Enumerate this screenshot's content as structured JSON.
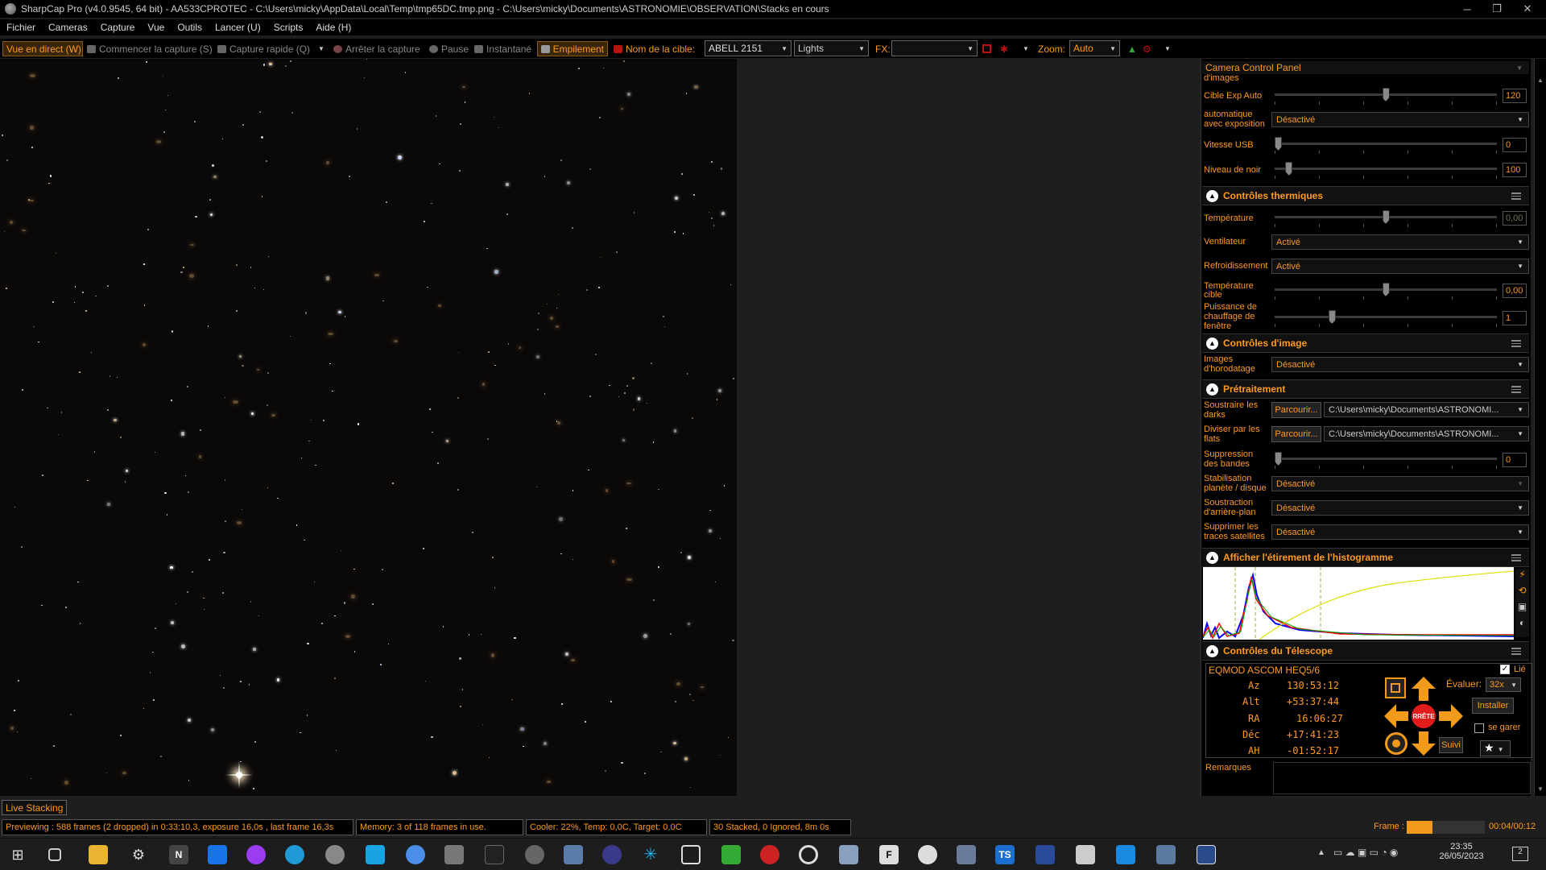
{
  "window": {
    "title": "SharpCap Pro (v4.0.9545, 64 bit) - AA533CPROTEC - C:\\Users\\micky\\AppData\\Local\\Temp\\tmp65DC.tmp.png - C:\\Users\\micky\\Documents\\ASTRONOMIE\\OBSERVATION\\Stacks en cours",
    "minimize": "─",
    "restore": "❐",
    "close": "✕"
  },
  "menu": [
    "Fichier",
    "Cameras",
    "Capture",
    "Vue",
    "Outils",
    "Lancer (U)",
    "Scripts",
    "Aide (H)"
  ],
  "toolbar": {
    "live_view": "Vue en direct (W)",
    "start_capture": "Commencer la capture (S)",
    "quick_capture": "Capture rapide (Q)",
    "stop_capture": "Arrêter la capture",
    "pause": "Pause",
    "snapshot": "Instantané",
    "stacking": "Empilement",
    "target_label": "Nom de la cible:",
    "target_value": "ABELL 2151",
    "frame_type": "Lights",
    "fx_label": "FX:",
    "fx_value": "",
    "zoom_label": "Zoom:",
    "zoom_value": "Auto"
  },
  "panel": {
    "title": "Camera Control Panel",
    "cut_label": "d'images",
    "cible_exp": {
      "label": "Cible Exp Auto",
      "value": "120",
      "level": 0.5
    },
    "auto_gain": {
      "label1": "automatique",
      "label2": "avec exposition",
      "value": "Désactivé"
    },
    "usb": {
      "label": "Vitesse USB",
      "value": "0",
      "level": 0.0
    },
    "black": {
      "label": "Niveau de noir",
      "value": "100",
      "level": 0.05
    },
    "thermal": {
      "header": "Contrôles thermiques",
      "temp": {
        "label": "Température",
        "value": "0,00",
        "level": 0.5
      },
      "fan": {
        "label": "Ventilateur",
        "value": "Activé"
      },
      "cooling": {
        "label": "Refroidissement",
        "value": "Activé"
      },
      "target_temp": {
        "label1": "Température",
        "label2": "cible",
        "value": "0,00",
        "level": 0.5
      },
      "heater": {
        "label1": "Puissance de",
        "label2": "chauffage de",
        "label3": "fenêtre",
        "value": "1",
        "level": 0.25
      }
    },
    "image": {
      "header": "Contrôles d'image",
      "timestamp": {
        "label1": "Images",
        "label2": "d'horodatage",
        "value": "Désactivé"
      }
    },
    "preproc": {
      "header": "Prétraitement",
      "darks": {
        "label1": "Soustraire les",
        "label2": "darks",
        "browse": "Parcourir...",
        "path": "C:\\Users\\micky\\Documents\\ASTRONOMI..."
      },
      "flats": {
        "label1": "Diviser par les",
        "label2": "flats",
        "browse": "Parcourir...",
        "path": "C:\\Users\\micky\\Documents\\ASTRONOMI..."
      },
      "banding": {
        "label1": "Suppression",
        "label2": "des bandes",
        "value": "0",
        "level": 0.0
      },
      "stabilize": {
        "label1": "Stabilisation",
        "label2": "planète / disque",
        "value": "Désactivé"
      },
      "background": {
        "label1": "Soustraction",
        "label2": "d'arrière-plan",
        "value": "Désactivé"
      },
      "satellites": {
        "label1": "Supprimer les",
        "label2": "traces satellites",
        "value": "Désactivé"
      }
    },
    "histogram": {
      "header": "Afficher l'étirement de l'histogramme"
    },
    "telescope": {
      "header": "Contrôles du Télescope",
      "mount": "EQMOD ASCOM HEQ5/6",
      "linked": "Lié",
      "az_label": "Az",
      "az": "130:53:12",
      "alt_label": "Alt",
      "alt": "+53:37:44",
      "ra_label": "RA",
      "ra": "16:06:27",
      "dec_label": "Déc",
      "dec": "+17:41:23",
      "ha_label": "AH",
      "ha": "-01:52:17",
      "stop": "RRÊTE",
      "rate_label": "Évaluer:",
      "rate": "32x",
      "install": "Installer",
      "park": "se garer",
      "track": "Suivi"
    },
    "remarks": "Remarques"
  },
  "live_stacking": "Live Stacking",
  "status": {
    "previewing": "Previewing : 588 frames (2 dropped) in 0:33:10,3, exposure 16,0s , last frame 16,3s",
    "memory": "Memory: 3 of 118 frames in use.",
    "cooler": "Cooler: 22%, Temp: 0,0C, Target: 0,0C",
    "stacked": "30 Stacked, 0 Ignored, 8m 0s",
    "frame_label": "Frame :",
    "frame_time": "00:04/00:12",
    "frame_progress": 0.33
  },
  "taskbar": {
    "time": "23:35",
    "date": "26/05/2023",
    "notif": "2"
  },
  "colors": {
    "accent": "#ff9a1f",
    "stop_red": "#e21b1b",
    "arrow_orange": "#f29a1a"
  }
}
